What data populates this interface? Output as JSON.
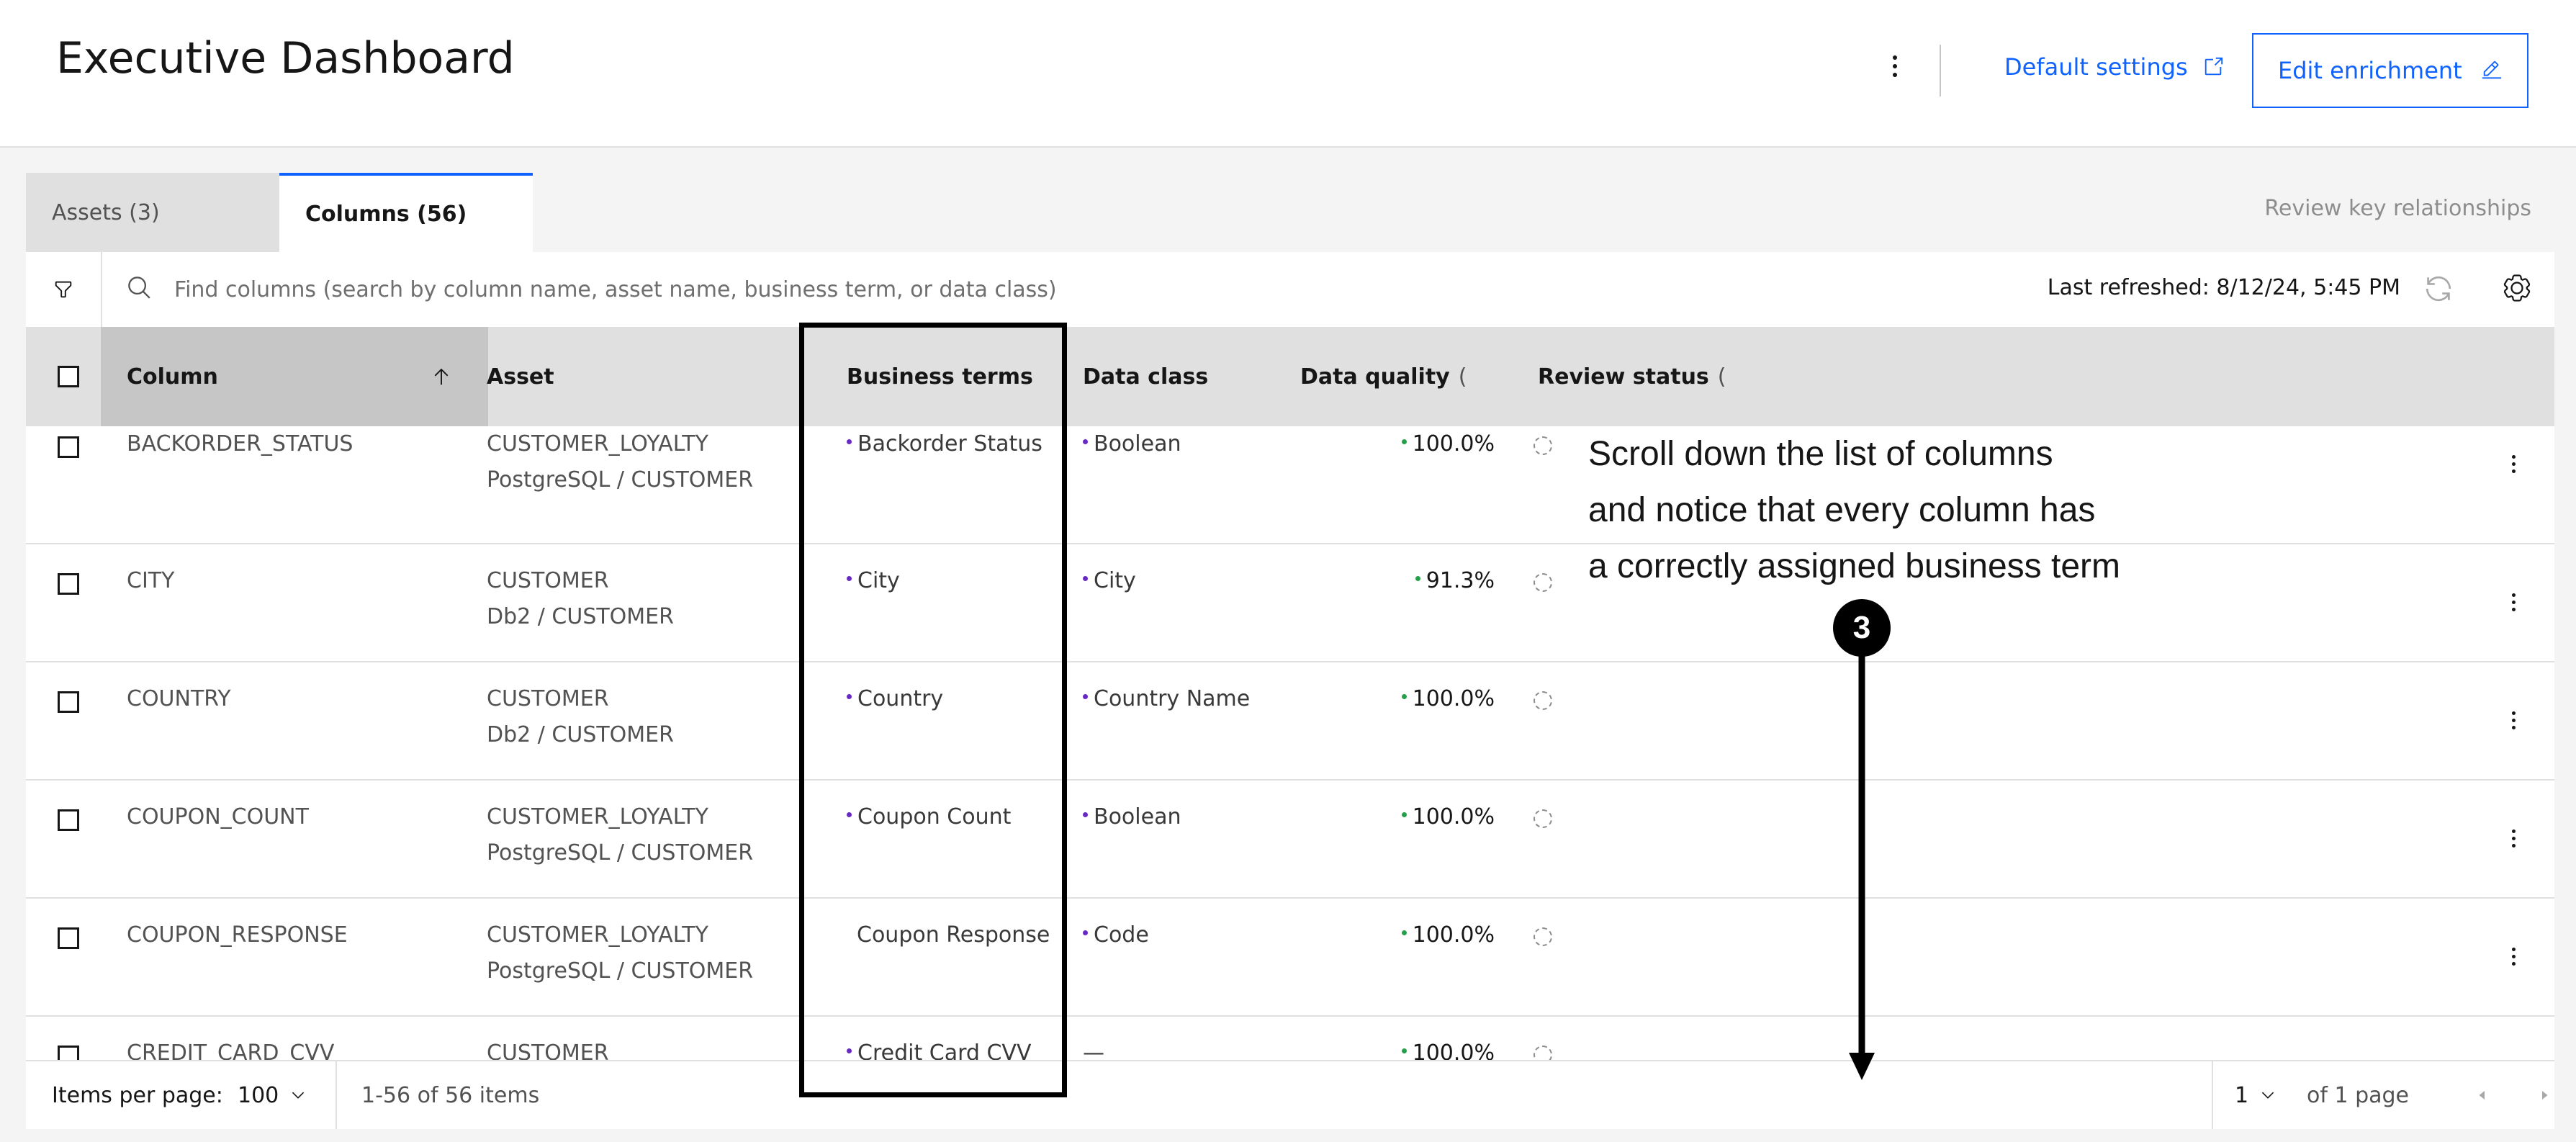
{
  "header": {
    "title": "Executive Dashboard",
    "default_settings": "Default settings",
    "edit_enrichment": "Edit enrichment"
  },
  "tabs": [
    {
      "label": "Assets (3)",
      "active": false
    },
    {
      "label": "Columns (56)",
      "active": true
    }
  ],
  "review_key_relationships": "Review key relationships",
  "toolbar": {
    "search_placeholder": "Find columns (search by column name, asset name, business term, or data class)",
    "last_refreshed": "Last refreshed: 8/12/24, 5:45 PM"
  },
  "table": {
    "headers": {
      "column": "Column",
      "asset": "Asset",
      "business_terms": "Business terms",
      "data_class": "Data class",
      "data_quality": "Data quality",
      "review_status": "Review status"
    },
    "sorted_by": "column",
    "sort_direction": "ascending",
    "rows": [
      {
        "column": "BACKORDER_STATUS",
        "asset": "CUSTOMER_LOYALTY",
        "asset_path": "PostgreSQL  /  CUSTOMER",
        "term": "Backorder Status",
        "term_dot": true,
        "data_class": "Boolean",
        "class_dot": true,
        "quality": "100.0%"
      },
      {
        "column": "CITY",
        "asset": "CUSTOMER",
        "asset_path": "Db2  /  CUSTOMER",
        "term": "City",
        "term_dot": true,
        "data_class": "City",
        "class_dot": true,
        "quality": "91.3%"
      },
      {
        "column": "COUNTRY",
        "asset": "CUSTOMER",
        "asset_path": "Db2  /  CUSTOMER",
        "term": "Country",
        "term_dot": true,
        "data_class": "Country Name",
        "class_dot": true,
        "quality": "100.0%"
      },
      {
        "column": "COUPON_COUNT",
        "asset": "CUSTOMER_LOYALTY",
        "asset_path": "PostgreSQL  /  CUSTOMER",
        "term": "Coupon Count",
        "term_dot": true,
        "data_class": "Boolean",
        "class_dot": true,
        "quality": "100.0%"
      },
      {
        "column": "COUPON_RESPONSE",
        "asset": "CUSTOMER_LOYALTY",
        "asset_path": "PostgreSQL  /  CUSTOMER",
        "term": "Coupon Response",
        "term_dot": false,
        "data_class": "Code",
        "class_dot": true,
        "quality": "100.0%"
      },
      {
        "column": "CREDIT_CARD_CVV",
        "asset": "CUSTOMER",
        "asset_path": "",
        "term": "Credit Card CVV",
        "term_dot": true,
        "data_class": "—",
        "class_dot": false,
        "quality": "100.0%"
      }
    ]
  },
  "pagination": {
    "items_per_page_label": "Items per page:",
    "items_per_page": "100",
    "range": "1-56 of 56 items",
    "page": "1",
    "of_pages": "of 1 page"
  },
  "annotation": {
    "lines": [
      "Scroll down the list of columns",
      "and notice that every column has",
      "a correctly assigned business term"
    ],
    "step": "3"
  },
  "colors": {
    "accent": "#0f62fe",
    "term_dot": "#6929c4",
    "quality_dot": "#24a148"
  }
}
